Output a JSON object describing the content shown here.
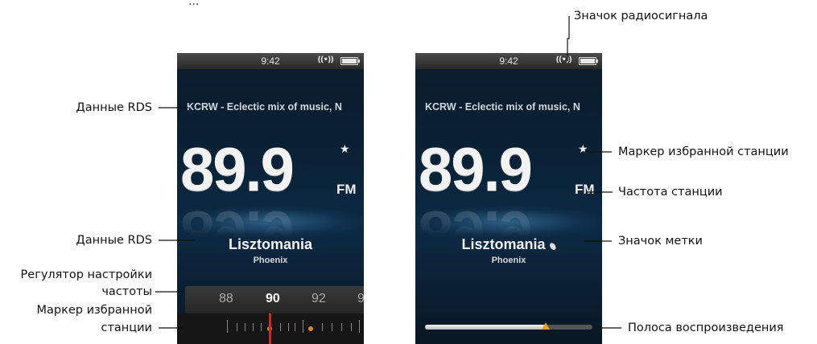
{
  "top_caption": "...",
  "left_phone": {
    "time": "9:42",
    "rds_text": "KCRW - Eclectic mix of music, N",
    "frequency": "89.9",
    "band": "FM",
    "favorite_star": "★",
    "song": "Lisztomania",
    "artist": "Phoenix",
    "tuner_labels": [
      "88",
      "90",
      "92",
      "9"
    ]
  },
  "right_phone": {
    "time": "9:42",
    "rds_text": "KCRW - Eclectic mix of music, N",
    "frequency": "89.9",
    "band": "FM",
    "favorite_star": "★",
    "song": "Lisztomania",
    "artist": "Phoenix",
    "playback_progress": 0.72
  },
  "callouts": {
    "rds_data_top": "Данные RDS",
    "rds_data_bottom": "Данные RDS",
    "tuner_line1": "Регулятор настройки",
    "tuner_line2": "частоты",
    "fav_marker_line1": "Маркер избранной",
    "fav_marker_line2": "станции",
    "radio_signal_icon": "Значок радиосигнала",
    "fav_station_marker": "Маркер избранной станции",
    "station_frequency": "Частота станции",
    "tag_icon": "Значок метки",
    "playback_bar": "Полоса воспроизведения"
  },
  "colors": {
    "background": "#ffffff",
    "screen_dark": "#0b1a2a",
    "needle": "#d2282a",
    "favorite_dot": "#e08a1e"
  }
}
